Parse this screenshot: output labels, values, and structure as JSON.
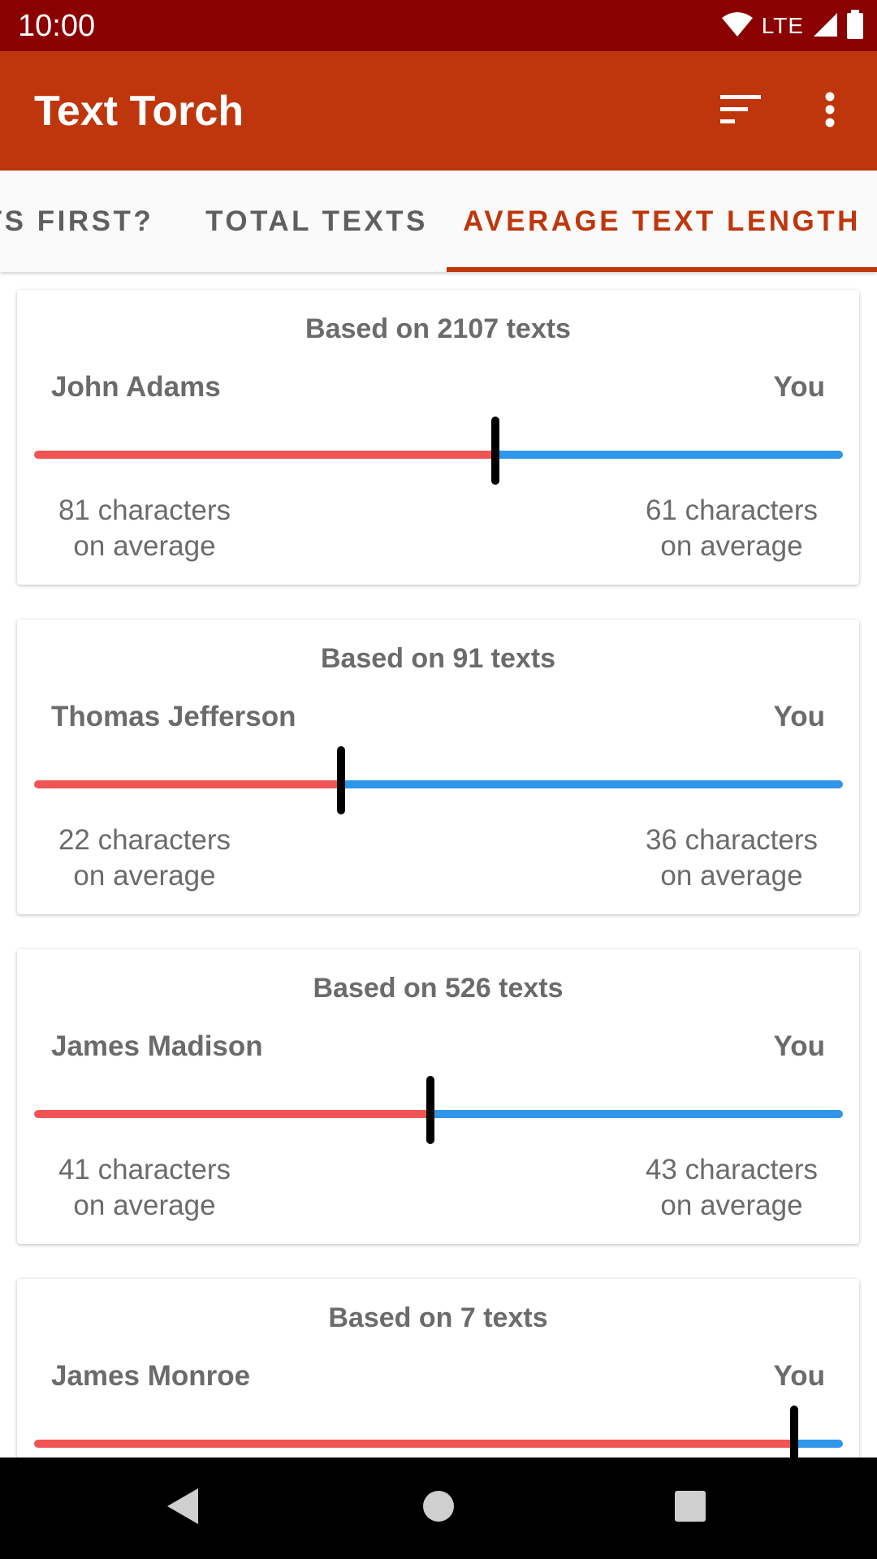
{
  "status_bar": {
    "time": "10:00",
    "network": "LTE",
    "icons": [
      "wifi-icon",
      "cell-signal-icon",
      "battery-icon"
    ],
    "background": "#8b0000"
  },
  "app_bar": {
    "title": "Text Torch",
    "background": "#bf360c",
    "actions": [
      "sort-icon",
      "more-vert-icon"
    ]
  },
  "tabs": [
    {
      "label": "TS FIRST?",
      "selected": false
    },
    {
      "label": "TOTAL TEXTS",
      "selected": false
    },
    {
      "label": "AVERAGE TEXT LENGTH",
      "selected": true
    }
  ],
  "colors": {
    "accent": "#bf360c",
    "contact_bar": "#f05454",
    "you_bar": "#2f96ea",
    "marker": "#000000",
    "text_secondary": "#6b6b6b"
  },
  "cards": [
    {
      "title": "Based on 2107 texts",
      "contact": "John Adams",
      "you_label": "You",
      "contact_line1": "81 characters",
      "contact_line2": "on average",
      "you_line1": "61 characters",
      "you_line2": "on average",
      "contact_share": 0.57
    },
    {
      "title": "Based on 91 texts",
      "contact": "Thomas Jefferson",
      "you_label": "You",
      "contact_line1": "22 characters",
      "contact_line2": "on average",
      "you_line1": "36 characters",
      "you_line2": "on average",
      "contact_share": 0.38
    },
    {
      "title": "Based on 526 texts",
      "contact": "James Madison",
      "you_label": "You",
      "contact_line1": "41 characters",
      "contact_line2": "on average",
      "you_line1": "43 characters",
      "you_line2": "on average",
      "contact_share": 0.49
    },
    {
      "title": "Based on 7 texts",
      "contact": "James Monroe",
      "you_label": "You",
      "contact_line1": "",
      "contact_line2": "",
      "you_line1": "",
      "you_line2": "",
      "contact_share": 0.94
    }
  ],
  "nav_bar": {
    "buttons": [
      "back-icon",
      "home-icon",
      "recents-icon"
    ]
  }
}
